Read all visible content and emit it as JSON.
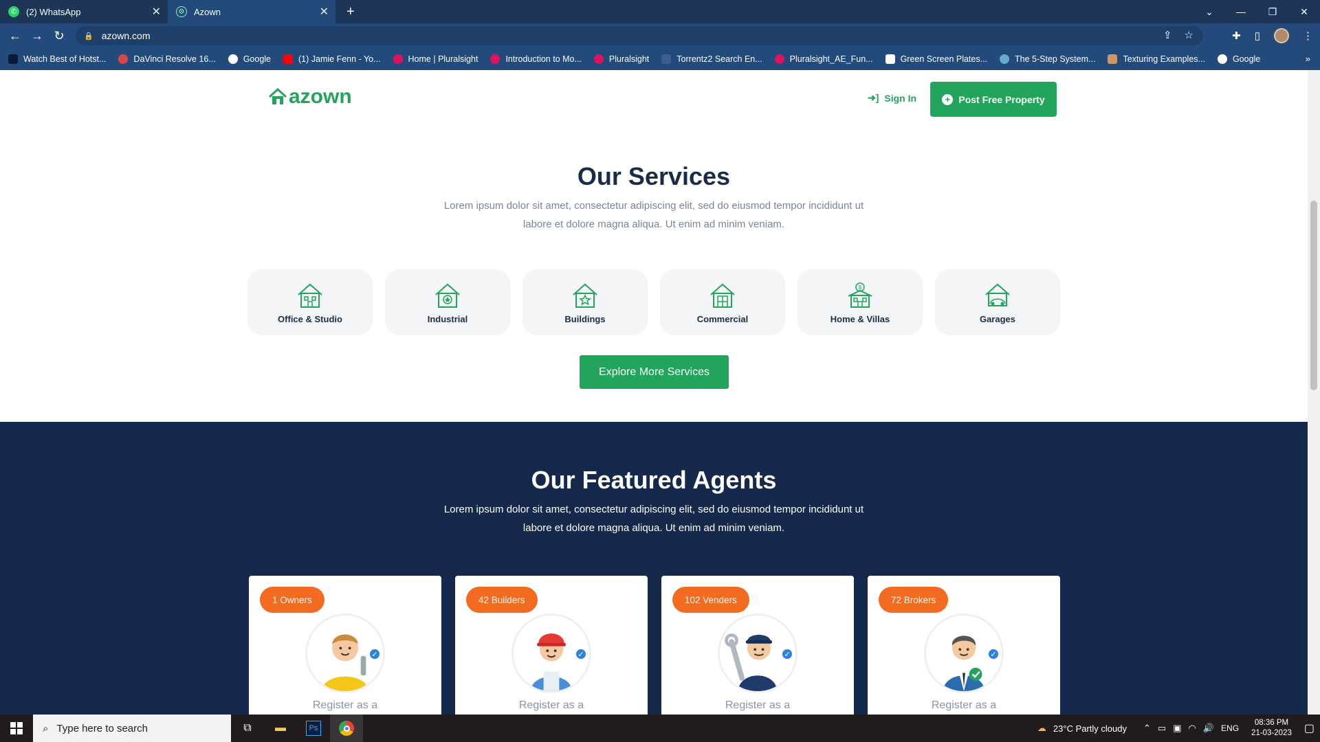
{
  "browser": {
    "tabs": [
      {
        "title": "(2) WhatsApp",
        "active": false
      },
      {
        "title": "Azown",
        "active": true
      }
    ],
    "url": "azown.com",
    "bookmarks": [
      "Watch Best of Hotst...",
      "DaVinci Resolve 16...",
      "Google",
      "(1) Jamie Fenn - Yo...",
      "Home | Pluralsight",
      "Introduction to Mo...",
      "Pluralsight",
      "Torrentz2 Search En...",
      "Pluralsight_AE_Fun...",
      "Green Screen Plates...",
      "The 5-Step System...",
      "Texturing Examples...",
      "Google"
    ]
  },
  "site": {
    "logo": "azown",
    "sign_in": "Sign In",
    "post_property": "Post Free Property",
    "services": {
      "title": "Our Services",
      "subtitle_line1": "Lorem ipsum dolor sit amet, consectetur adipiscing elit, sed do eiusmod tempor incididunt ut",
      "subtitle_line2": "labore et dolore magna aliqua. Ut enim ad minim veniam.",
      "items": [
        "Office & Studio",
        "Industrial",
        "Buildings",
        "Commercial",
        "Home & Villas",
        "Garages"
      ],
      "explore": "Explore More Services"
    },
    "agents": {
      "title": "Our Featured Agents",
      "subtitle_line1": "Lorem ipsum dolor sit amet, consectetur adipiscing elit, sed do eiusmod tempor incididunt ut",
      "subtitle_line2": "labore et dolore magna aliqua. Ut enim ad minim veniam.",
      "cards": [
        {
          "badge": "1 Owners",
          "text": "Register as a"
        },
        {
          "badge": "42 Builders",
          "text": "Register as a"
        },
        {
          "badge": "102 Venders",
          "text": "Register as a"
        },
        {
          "badge": "72 Brokers",
          "text": "Register as a"
        }
      ]
    }
  },
  "taskbar": {
    "search_placeholder": "Type here to search",
    "weather": "23°C  Partly cloudy",
    "lang": "ENG",
    "time": "08:36 PM",
    "date": "21-03-2023"
  },
  "colors": {
    "brand_green": "#22a45d",
    "navy": "#15294d",
    "orange": "#f26b21"
  }
}
